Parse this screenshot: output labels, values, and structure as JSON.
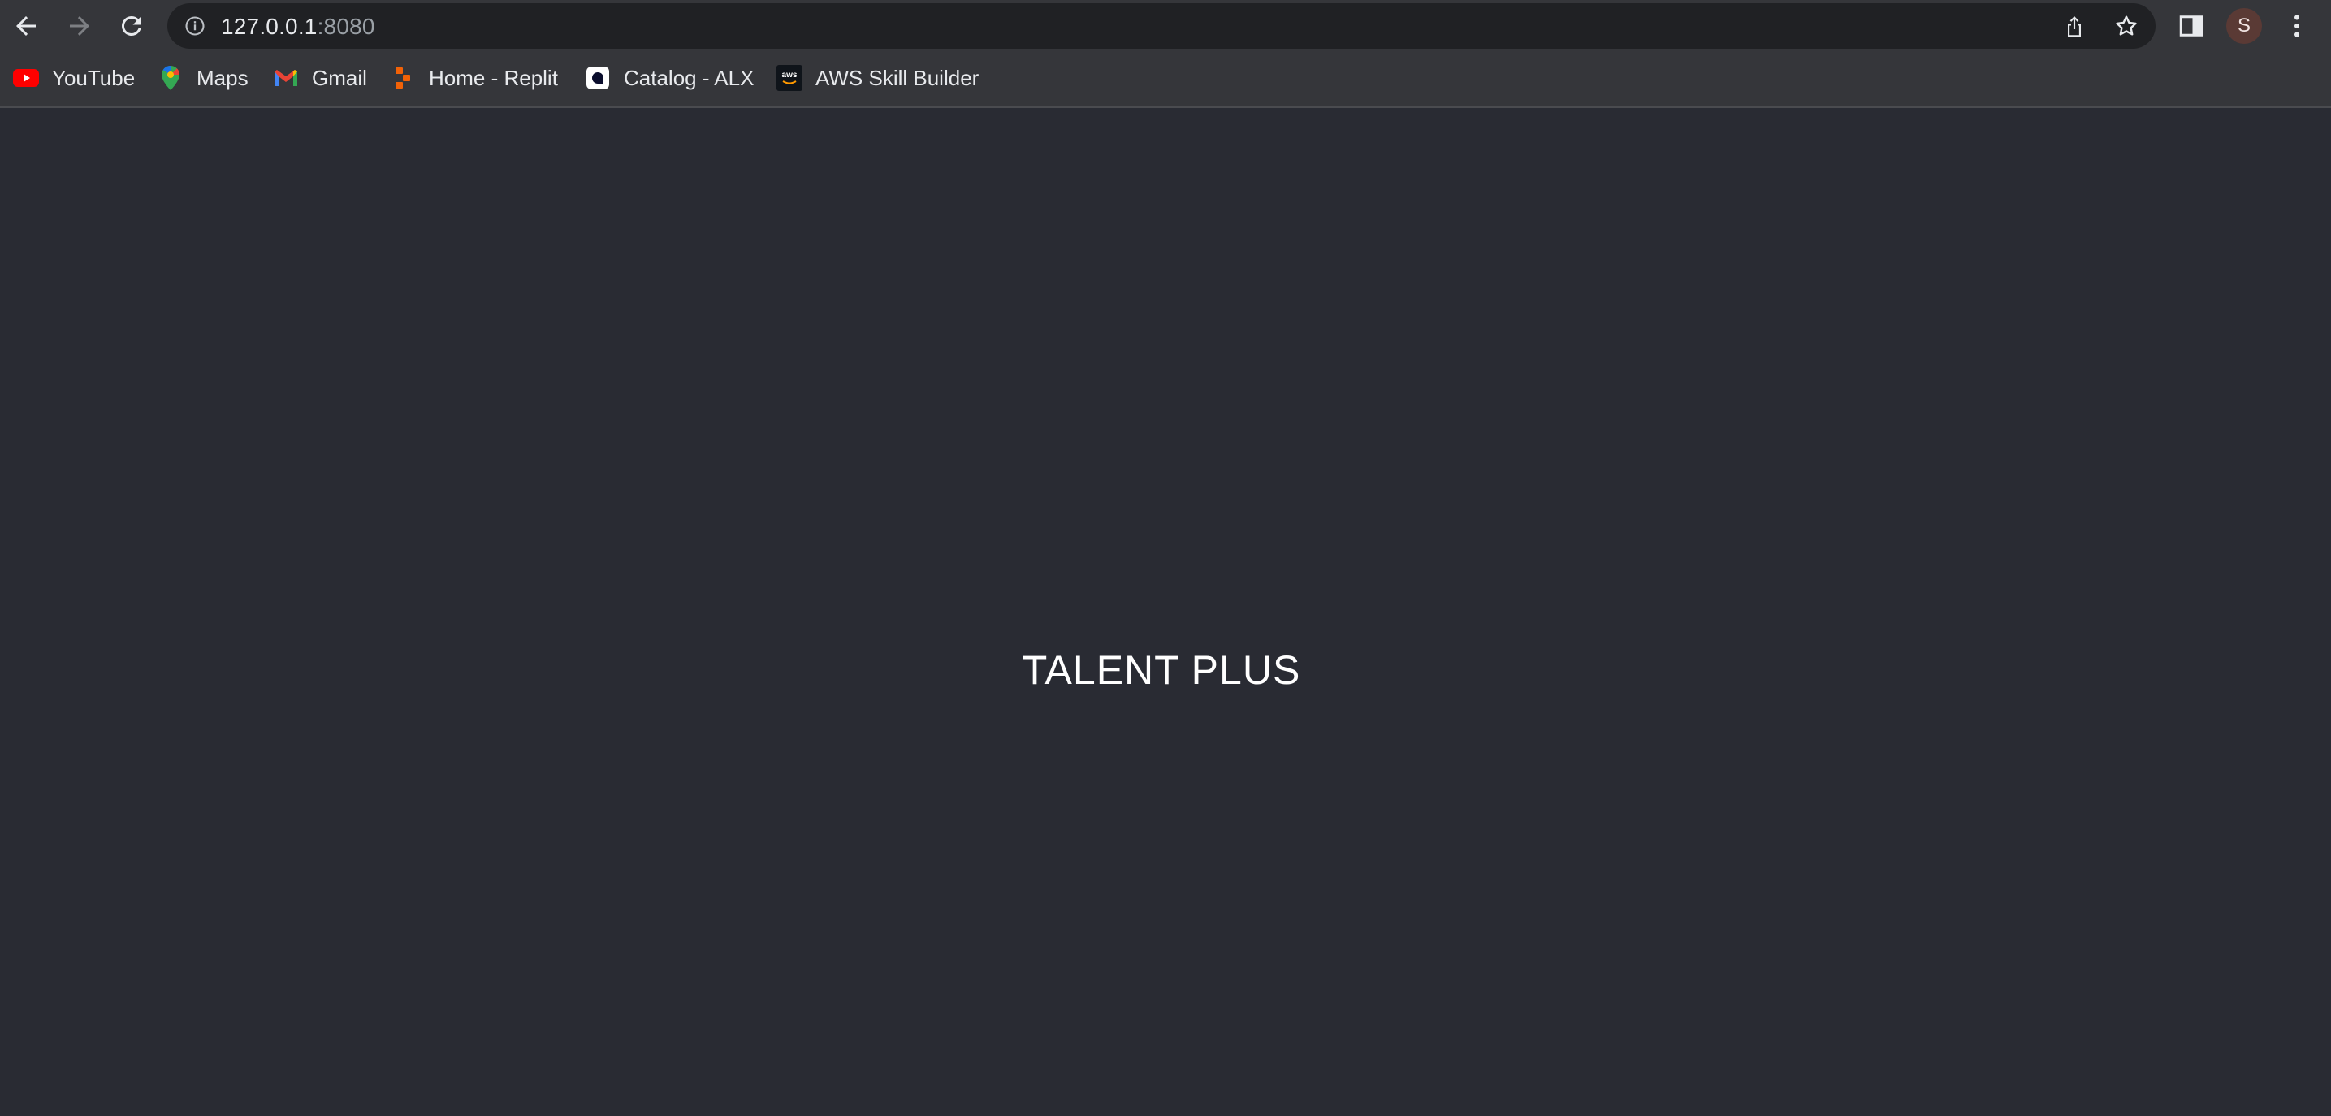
{
  "browser": {
    "url_host": "127.0.0.1",
    "url_port": ":8080",
    "profile_initial": "S"
  },
  "bookmarks": [
    {
      "label": "YouTube",
      "icon": "youtube-icon"
    },
    {
      "label": "Maps",
      "icon": "maps-icon"
    },
    {
      "label": "Gmail",
      "icon": "gmail-icon"
    },
    {
      "label": "Home - Replit",
      "icon": "replit-icon"
    },
    {
      "label": "Catalog - ALX",
      "icon": "alx-icon"
    },
    {
      "label": "AWS Skill Builder",
      "icon": "aws-icon"
    }
  ],
  "page": {
    "title": "TALENT PLUS"
  },
  "colors": {
    "page_background": "#292b33",
    "chrome_background": "#35363a",
    "omnibox_background": "#202124",
    "text_primary": "#e8eaed"
  }
}
